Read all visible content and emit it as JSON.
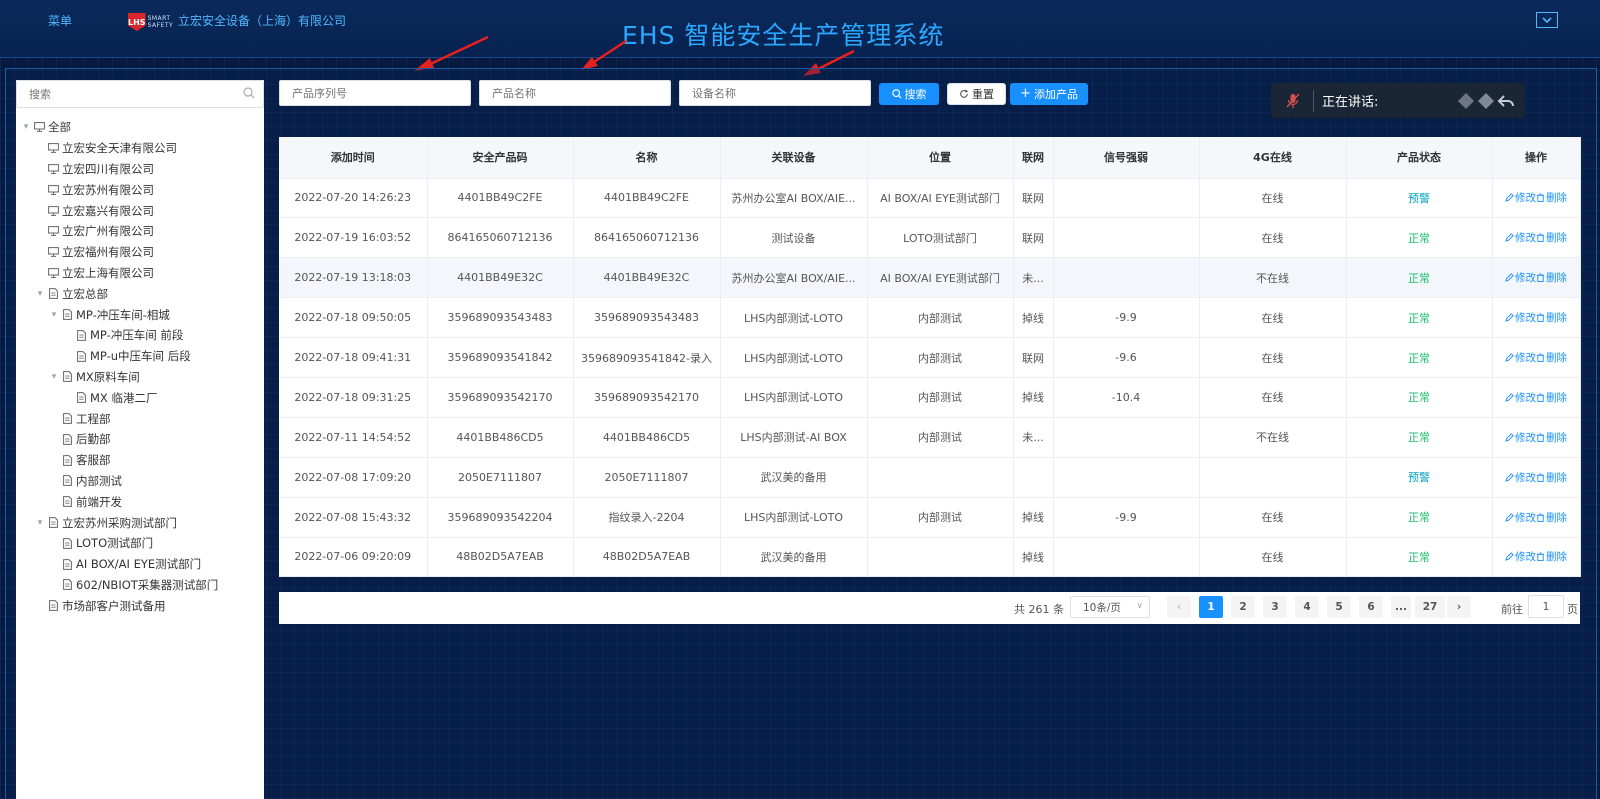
{
  "header": {
    "menu_label": "菜单",
    "logo_text": "SMART SAFETY",
    "logo_mark": "LHS",
    "company": "立宏安全设备（上海）有限公司",
    "system_title": "EHS 智能安全生产管理系统",
    "dropdown_icon": "chevron-down-icon"
  },
  "sidebar": {
    "search_placeholder": "搜索",
    "tree": [
      {
        "label": "全部",
        "level": 0,
        "caret": "▾",
        "icon": "monitor"
      },
      {
        "label": "立宏安全天津有限公司",
        "level": 1,
        "caret": "",
        "icon": "monitor"
      },
      {
        "label": "立宏四川有限公司",
        "level": 1,
        "caret": "",
        "icon": "monitor"
      },
      {
        "label": "立宏苏州有限公司",
        "level": 1,
        "caret": "",
        "icon": "monitor"
      },
      {
        "label": "立宏嘉兴有限公司",
        "level": 1,
        "caret": "",
        "icon": "monitor"
      },
      {
        "label": "立宏广州有限公司",
        "level": 1,
        "caret": "",
        "icon": "monitor"
      },
      {
        "label": "立宏福州有限公司",
        "level": 1,
        "caret": "",
        "icon": "monitor"
      },
      {
        "label": "立宏上海有限公司",
        "level": 1,
        "caret": "",
        "icon": "monitor"
      },
      {
        "label": "立宏总部",
        "level": 1,
        "caret": "▾",
        "icon": "doc"
      },
      {
        "label": "MP-冲压车间-相城",
        "level": 2,
        "caret": "▾",
        "icon": "doc"
      },
      {
        "label": "MP-冲压车间 前段",
        "level": 3,
        "caret": "",
        "icon": "doc"
      },
      {
        "label": "MP-u中压车间 后段",
        "level": 3,
        "caret": "",
        "icon": "doc"
      },
      {
        "label": "MX原料车间",
        "level": 2,
        "caret": "▾",
        "icon": "doc"
      },
      {
        "label": "MX 临港二厂",
        "level": 3,
        "caret": "",
        "icon": "doc"
      },
      {
        "label": "工程部",
        "level": 2,
        "caret": "",
        "icon": "doc"
      },
      {
        "label": "后勤部",
        "level": 2,
        "caret": "",
        "icon": "doc"
      },
      {
        "label": "客服部",
        "level": 2,
        "caret": "",
        "icon": "doc"
      },
      {
        "label": "内部测试",
        "level": 2,
        "caret": "",
        "icon": "doc"
      },
      {
        "label": "前端开发",
        "level": 2,
        "caret": "",
        "icon": "doc"
      },
      {
        "label": "立宏苏州采购测试部门",
        "level": 1,
        "caret": "▾",
        "icon": "doc"
      },
      {
        "label": "LOTO测试部门",
        "level": 2,
        "caret": "",
        "icon": "doc"
      },
      {
        "label": "AI BOX/AI EYE测试部门",
        "level": 2,
        "caret": "",
        "icon": "doc"
      },
      {
        "label": "602/NBIOT采集器测试部门",
        "level": 2,
        "caret": "",
        "icon": "doc"
      },
      {
        "label": "市场部客户测试备用",
        "level": 1,
        "caret": "",
        "icon": "doc"
      }
    ]
  },
  "toolbar": {
    "serial_placeholder": "产品序列号",
    "name_placeholder": "产品名称",
    "device_placeholder": "设备名称",
    "search_label": "搜索",
    "reset_label": "重置",
    "add_label": "添加产品"
  },
  "talk": {
    "label": "正在讲话:"
  },
  "table": {
    "columns": [
      "添加时间",
      "安全产品码",
      "名称",
      "关联设备",
      "位置",
      "联网",
      "信号强弱",
      "4G在线",
      "产品状态",
      "操作"
    ],
    "edit_label": "修改",
    "delete_label": "删除",
    "rows": [
      {
        "time": "2022-07-20 14:26:23",
        "code": "4401BB49C2FE",
        "name": "4401BB49C2FE",
        "device": "苏州办公室AI BOX/AIE...",
        "location": "AI BOX/AI EYE测试部门",
        "net": "联网",
        "signal": "",
        "online": "在线",
        "status": "预警",
        "status_type": "warn"
      },
      {
        "time": "2022-07-19 16:03:52",
        "code": "864165060712136",
        "name": "864165060712136",
        "device": "测试设备",
        "location": "LOTO测试部门",
        "net": "联网",
        "signal": "",
        "online": "在线",
        "status": "正常",
        "status_type": "ok"
      },
      {
        "time": "2022-07-19 13:18:03",
        "code": "4401BB49E32C",
        "name": "4401BB49E32C",
        "device": "苏州办公室AI BOX/AIE...",
        "location": "AI BOX/AI EYE测试部门",
        "net": "未...",
        "signal": "",
        "online": "不在线",
        "status": "正常",
        "status_type": "ok"
      },
      {
        "time": "2022-07-18 09:50:05",
        "code": "359689093543483",
        "name": "359689093543483",
        "device": "LHS内部测试-LOTO",
        "location": "内部测试",
        "net": "掉线",
        "signal": "-9.9",
        "online": "在线",
        "status": "正常",
        "status_type": "ok"
      },
      {
        "time": "2022-07-18 09:41:31",
        "code": "359689093541842",
        "name": "359689093541842-录入",
        "device": "LHS内部测试-LOTO",
        "location": "内部测试",
        "net": "联网",
        "signal": "-9.6",
        "online": "在线",
        "status": "正常",
        "status_type": "ok"
      },
      {
        "time": "2022-07-18 09:31:25",
        "code": "359689093542170",
        "name": "359689093542170",
        "device": "LHS内部测试-LOTO",
        "location": "内部测试",
        "net": "掉线",
        "signal": "-10.4",
        "online": "在线",
        "status": "正常",
        "status_type": "ok"
      },
      {
        "time": "2022-07-11 14:54:52",
        "code": "4401BB486CD5",
        "name": "4401BB486CD5",
        "device": "LHS内部测试-AI BOX",
        "location": "内部测试",
        "net": "未...",
        "signal": "",
        "online": "不在线",
        "status": "正常",
        "status_type": "ok"
      },
      {
        "time": "2022-07-08 17:09:20",
        "code": "2050E7111807",
        "name": "2050E7111807",
        "device": "武汉美的备用",
        "location": "",
        "net": "",
        "signal": "",
        "online": "",
        "status": "预警",
        "status_type": "warn"
      },
      {
        "time": "2022-07-08 15:43:32",
        "code": "359689093542204",
        "name": "指纹录入-2204",
        "device": "LHS内部测试-LOTO",
        "location": "内部测试",
        "net": "掉线",
        "signal": "-9.9",
        "online": "在线",
        "status": "正常",
        "status_type": "ok"
      },
      {
        "time": "2022-07-06 09:20:09",
        "code": "48B02D5A7EAB",
        "name": "48B02D5A7EAB",
        "device": "武汉美的备用",
        "location": "",
        "net": "掉线",
        "signal": "",
        "online": "在线",
        "status": "正常",
        "status_type": "ok"
      }
    ]
  },
  "pagination": {
    "total": "共 261 条",
    "page_size": "10条/页",
    "pages": [
      "1",
      "2",
      "3",
      "4",
      "5",
      "6",
      "...",
      "27"
    ],
    "current": "1",
    "goto_label": "前往",
    "goto_value": "1",
    "page_unit": "页"
  },
  "colors": {
    "accent": "#1890ff",
    "title": "#2aa8ff",
    "ok": "#19be6b",
    "warn": "#00a1c2",
    "arrow": "#e8201f"
  }
}
